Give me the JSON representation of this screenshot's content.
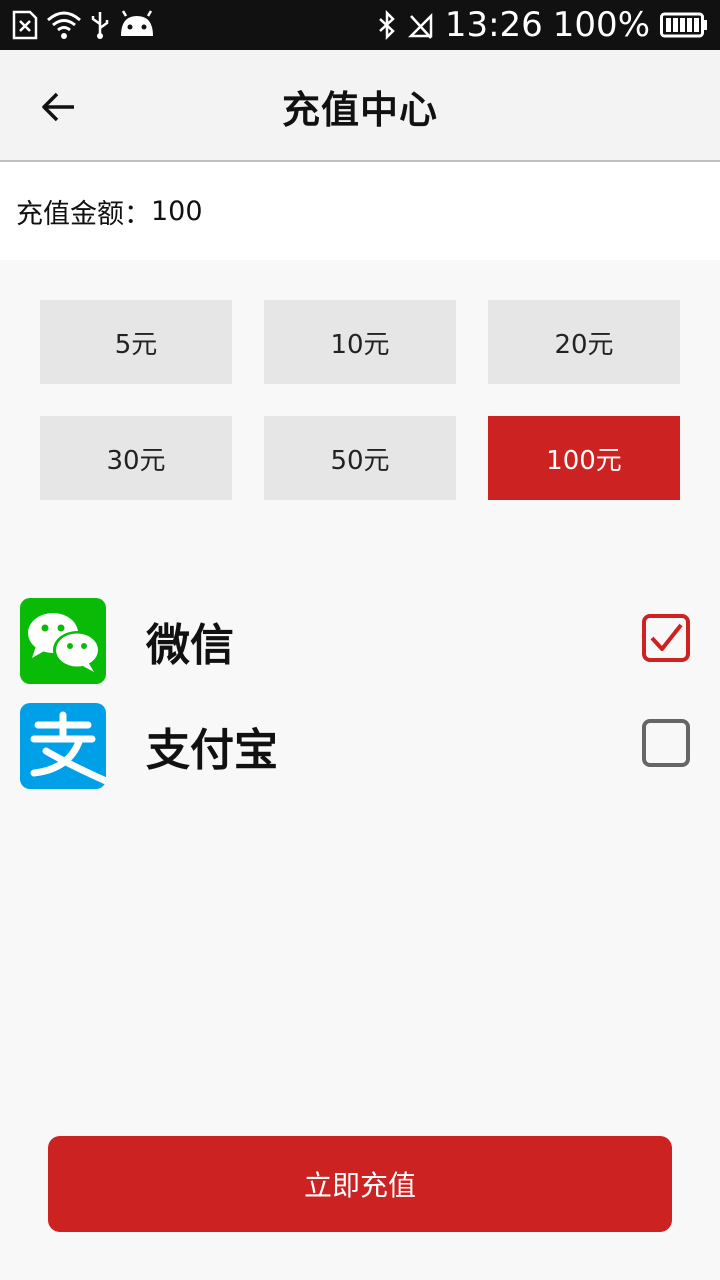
{
  "status_bar": {
    "time": "13:26",
    "battery_percent": "100%",
    "icons": [
      "sim-missing-icon",
      "wifi-icon",
      "usb-icon",
      "android-icon",
      "bluetooth-icon",
      "no-signal-icon",
      "battery-icon"
    ]
  },
  "header": {
    "title": "充值中心",
    "back_icon": "arrow-left-icon"
  },
  "amount": {
    "label": "充值金额：",
    "value": "100"
  },
  "options": [
    {
      "label": "5元",
      "selected": false
    },
    {
      "label": "10元",
      "selected": false
    },
    {
      "label": "20元",
      "selected": false
    },
    {
      "label": "30元",
      "selected": false
    },
    {
      "label": "50元",
      "selected": false
    },
    {
      "label": "100元",
      "selected": true
    }
  ],
  "payment_methods": [
    {
      "label": "微信",
      "icon": "wechat-icon",
      "checked": true
    },
    {
      "label": "支付宝",
      "icon": "alipay-icon",
      "checked": false
    }
  ],
  "submit": {
    "label": "立即充值"
  },
  "colors": {
    "accent": "#cc2222",
    "wechat": "#09bb07",
    "alipay": "#00a0e9"
  }
}
